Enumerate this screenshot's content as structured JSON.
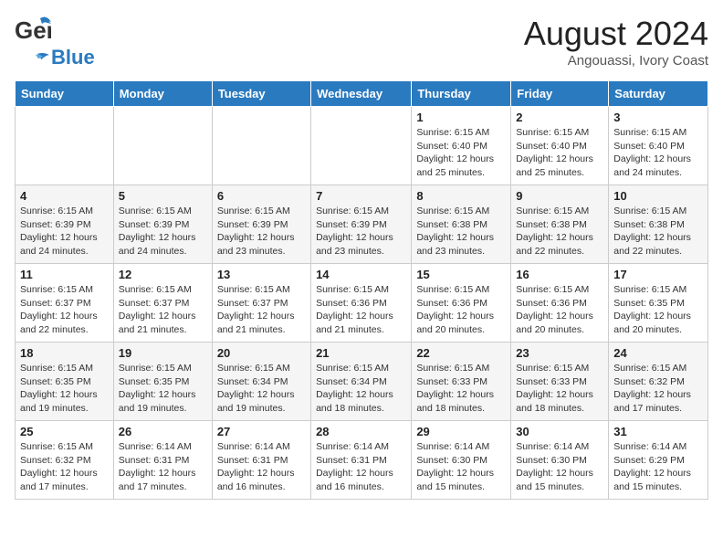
{
  "header": {
    "logo_general": "General",
    "logo_blue": "Blue",
    "main_title": "August 2024",
    "subtitle": "Angouassi, Ivory Coast"
  },
  "calendar": {
    "days_of_week": [
      "Sunday",
      "Monday",
      "Tuesday",
      "Wednesday",
      "Thursday",
      "Friday",
      "Saturday"
    ],
    "weeks": [
      [
        {
          "day": "",
          "info": ""
        },
        {
          "day": "",
          "info": ""
        },
        {
          "day": "",
          "info": ""
        },
        {
          "day": "",
          "info": ""
        },
        {
          "day": "1",
          "info": "Sunrise: 6:15 AM\nSunset: 6:40 PM\nDaylight: 12 hours\nand 25 minutes."
        },
        {
          "day": "2",
          "info": "Sunrise: 6:15 AM\nSunset: 6:40 PM\nDaylight: 12 hours\nand 25 minutes."
        },
        {
          "day": "3",
          "info": "Sunrise: 6:15 AM\nSunset: 6:40 PM\nDaylight: 12 hours\nand 24 minutes."
        }
      ],
      [
        {
          "day": "4",
          "info": "Sunrise: 6:15 AM\nSunset: 6:39 PM\nDaylight: 12 hours\nand 24 minutes."
        },
        {
          "day": "5",
          "info": "Sunrise: 6:15 AM\nSunset: 6:39 PM\nDaylight: 12 hours\nand 24 minutes."
        },
        {
          "day": "6",
          "info": "Sunrise: 6:15 AM\nSunset: 6:39 PM\nDaylight: 12 hours\nand 23 minutes."
        },
        {
          "day": "7",
          "info": "Sunrise: 6:15 AM\nSunset: 6:39 PM\nDaylight: 12 hours\nand 23 minutes."
        },
        {
          "day": "8",
          "info": "Sunrise: 6:15 AM\nSunset: 6:38 PM\nDaylight: 12 hours\nand 23 minutes."
        },
        {
          "day": "9",
          "info": "Sunrise: 6:15 AM\nSunset: 6:38 PM\nDaylight: 12 hours\nand 22 minutes."
        },
        {
          "day": "10",
          "info": "Sunrise: 6:15 AM\nSunset: 6:38 PM\nDaylight: 12 hours\nand 22 minutes."
        }
      ],
      [
        {
          "day": "11",
          "info": "Sunrise: 6:15 AM\nSunset: 6:37 PM\nDaylight: 12 hours\nand 22 minutes."
        },
        {
          "day": "12",
          "info": "Sunrise: 6:15 AM\nSunset: 6:37 PM\nDaylight: 12 hours\nand 21 minutes."
        },
        {
          "day": "13",
          "info": "Sunrise: 6:15 AM\nSunset: 6:37 PM\nDaylight: 12 hours\nand 21 minutes."
        },
        {
          "day": "14",
          "info": "Sunrise: 6:15 AM\nSunset: 6:36 PM\nDaylight: 12 hours\nand 21 minutes."
        },
        {
          "day": "15",
          "info": "Sunrise: 6:15 AM\nSunset: 6:36 PM\nDaylight: 12 hours\nand 20 minutes."
        },
        {
          "day": "16",
          "info": "Sunrise: 6:15 AM\nSunset: 6:36 PM\nDaylight: 12 hours\nand 20 minutes."
        },
        {
          "day": "17",
          "info": "Sunrise: 6:15 AM\nSunset: 6:35 PM\nDaylight: 12 hours\nand 20 minutes."
        }
      ],
      [
        {
          "day": "18",
          "info": "Sunrise: 6:15 AM\nSunset: 6:35 PM\nDaylight: 12 hours\nand 19 minutes."
        },
        {
          "day": "19",
          "info": "Sunrise: 6:15 AM\nSunset: 6:35 PM\nDaylight: 12 hours\nand 19 minutes."
        },
        {
          "day": "20",
          "info": "Sunrise: 6:15 AM\nSunset: 6:34 PM\nDaylight: 12 hours\nand 19 minutes."
        },
        {
          "day": "21",
          "info": "Sunrise: 6:15 AM\nSunset: 6:34 PM\nDaylight: 12 hours\nand 18 minutes."
        },
        {
          "day": "22",
          "info": "Sunrise: 6:15 AM\nSunset: 6:33 PM\nDaylight: 12 hours\nand 18 minutes."
        },
        {
          "day": "23",
          "info": "Sunrise: 6:15 AM\nSunset: 6:33 PM\nDaylight: 12 hours\nand 18 minutes."
        },
        {
          "day": "24",
          "info": "Sunrise: 6:15 AM\nSunset: 6:32 PM\nDaylight: 12 hours\nand 17 minutes."
        }
      ],
      [
        {
          "day": "25",
          "info": "Sunrise: 6:15 AM\nSunset: 6:32 PM\nDaylight: 12 hours\nand 17 minutes."
        },
        {
          "day": "26",
          "info": "Sunrise: 6:14 AM\nSunset: 6:31 PM\nDaylight: 12 hours\nand 17 minutes."
        },
        {
          "day": "27",
          "info": "Sunrise: 6:14 AM\nSunset: 6:31 PM\nDaylight: 12 hours\nand 16 minutes."
        },
        {
          "day": "28",
          "info": "Sunrise: 6:14 AM\nSunset: 6:31 PM\nDaylight: 12 hours\nand 16 minutes."
        },
        {
          "day": "29",
          "info": "Sunrise: 6:14 AM\nSunset: 6:30 PM\nDaylight: 12 hours\nand 15 minutes."
        },
        {
          "day": "30",
          "info": "Sunrise: 6:14 AM\nSunset: 6:30 PM\nDaylight: 12 hours\nand 15 minutes."
        },
        {
          "day": "31",
          "info": "Sunrise: 6:14 AM\nSunset: 6:29 PM\nDaylight: 12 hours\nand 15 minutes."
        }
      ]
    ]
  }
}
